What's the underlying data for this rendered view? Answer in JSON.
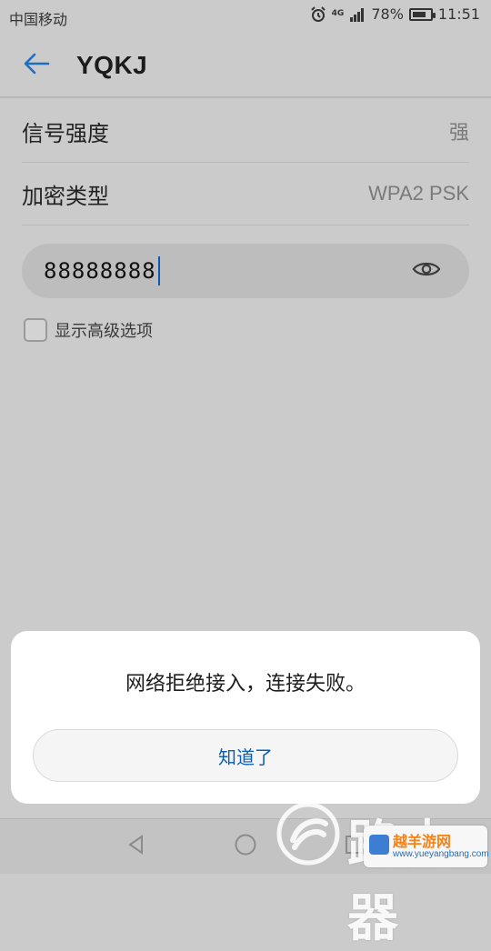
{
  "status_bar": {
    "carrier": "中国移动",
    "network": "4G",
    "battery_percent": "78%",
    "battery_level": 0.78,
    "time": "11:51",
    "icons": [
      "alarm-icon",
      "signal-icon",
      "battery-icon"
    ]
  },
  "appbar": {
    "title": "YQKJ",
    "back_icon": "arrow-left-icon"
  },
  "details": [
    {
      "label": "信号强度",
      "value": "强"
    },
    {
      "label": "加密类型",
      "value": "WPA2 PSK"
    }
  ],
  "password": {
    "value": "88888888",
    "toggle_icon": "eye-icon"
  },
  "advanced": {
    "checked": false,
    "label": "显示高级选项"
  },
  "dialog": {
    "message": "网络拒绝接入，连接失败。",
    "ok_label": "知道了"
  },
  "navbar": {
    "icons": [
      "back-triangle-icon",
      "home-circle-icon",
      "recents-square-icon"
    ]
  },
  "watermark": {
    "brand": "路由器",
    "badge_title": "越羊游网",
    "badge_url": "www.yueyangbang.com"
  },
  "colors": {
    "accent": "#0b5fb3",
    "dim_background": "#cbcbcb",
    "dialog_background": "#ffffff"
  }
}
